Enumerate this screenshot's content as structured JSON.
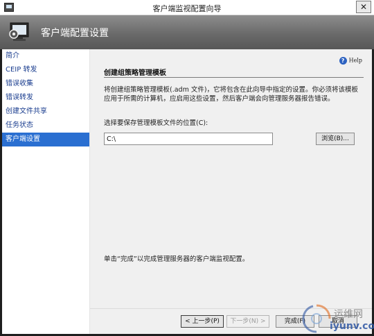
{
  "window": {
    "title": "客户端监视配置向导",
    "close_glyph": "✕"
  },
  "banner": {
    "title": "客户端配置设置",
    "icon": "gear-on-computer-icon"
  },
  "sidebar": {
    "items": [
      {
        "label": "简介",
        "active": false
      },
      {
        "label": "CEIP 转发",
        "active": false
      },
      {
        "label": "错误收集",
        "active": false
      },
      {
        "label": "错误转发",
        "active": false
      },
      {
        "label": "创建文件共享",
        "active": false
      },
      {
        "label": "任务状态",
        "active": false
      },
      {
        "label": "客户端设置",
        "active": true
      }
    ]
  },
  "main": {
    "help_label": "Help",
    "help_glyph": "?",
    "section_title": "创建组策略管理模板",
    "description": "将创建组策略管理模板(.adm 文件)，它将包含在此向导中指定的设置。你必须将该模板应用于所需的计算机，应启用这些设置，然后客户端会向管理服务器报告错误。",
    "field_label": "选择要保存管理模板文件的位置(C):",
    "path_value": "C:\\",
    "browse_label": "浏览(B)...",
    "footer_note": "单击“完成”以完成管理服务器的客户端监视配置。"
  },
  "footer": {
    "prev_label": "< 上一步(P)",
    "next_label": "下一步(N) >",
    "finish_label": "完成(F)",
    "cancel_label": "取消"
  },
  "watermark": {
    "line1": "运维网",
    "line2": "iyunv.com"
  },
  "colors": {
    "accent": "#2a6fd1",
    "nav_text": "#1a3d8f",
    "banner": "#6a6a6a",
    "content_bg": "#f0f0f0"
  }
}
